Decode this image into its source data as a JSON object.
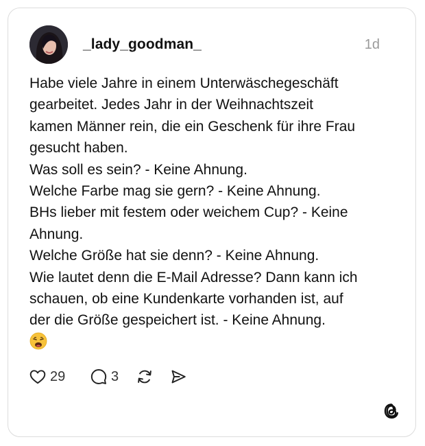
{
  "post": {
    "username": "_lady_goodman_",
    "time": "1d",
    "lines": [
      "Habe viele Jahre in einem Unterwäschegeschäft",
      "gearbeitet. Jedes Jahr in der Weihnachtszeit",
      "kamen Männer rein, die ein Geschenk für ihre Frau",
      "gesucht haben.",
      "Was soll es sein? - Keine Ahnung.",
      "Welche Farbe mag sie gern? - Keine Ahnung.",
      "BHs lieber mit festem oder weichem Cup? - Keine",
      "Ahnung.",
      "Welche Größe hat sie denn? - Keine Ahnung.",
      "Wie lautet denn die E-Mail Adresse? Dann kann ich",
      "schauen, ob eine Kundenkarte vorhanden ist, auf",
      "der die Größe gespeichert ist. - Keine Ahnung."
    ],
    "emoji_name": "weary-face-emoji"
  },
  "actions": {
    "likes": "29",
    "replies": "3",
    "icons": [
      "heart-icon",
      "comment-icon",
      "repost-icon",
      "share-icon"
    ]
  },
  "brand": {
    "logo": "threads-logo-icon"
  },
  "colors": {
    "text": "#111111",
    "muted": "#9a9a9a",
    "border": "#dcdcdc",
    "emoji": "#f7c23a"
  }
}
